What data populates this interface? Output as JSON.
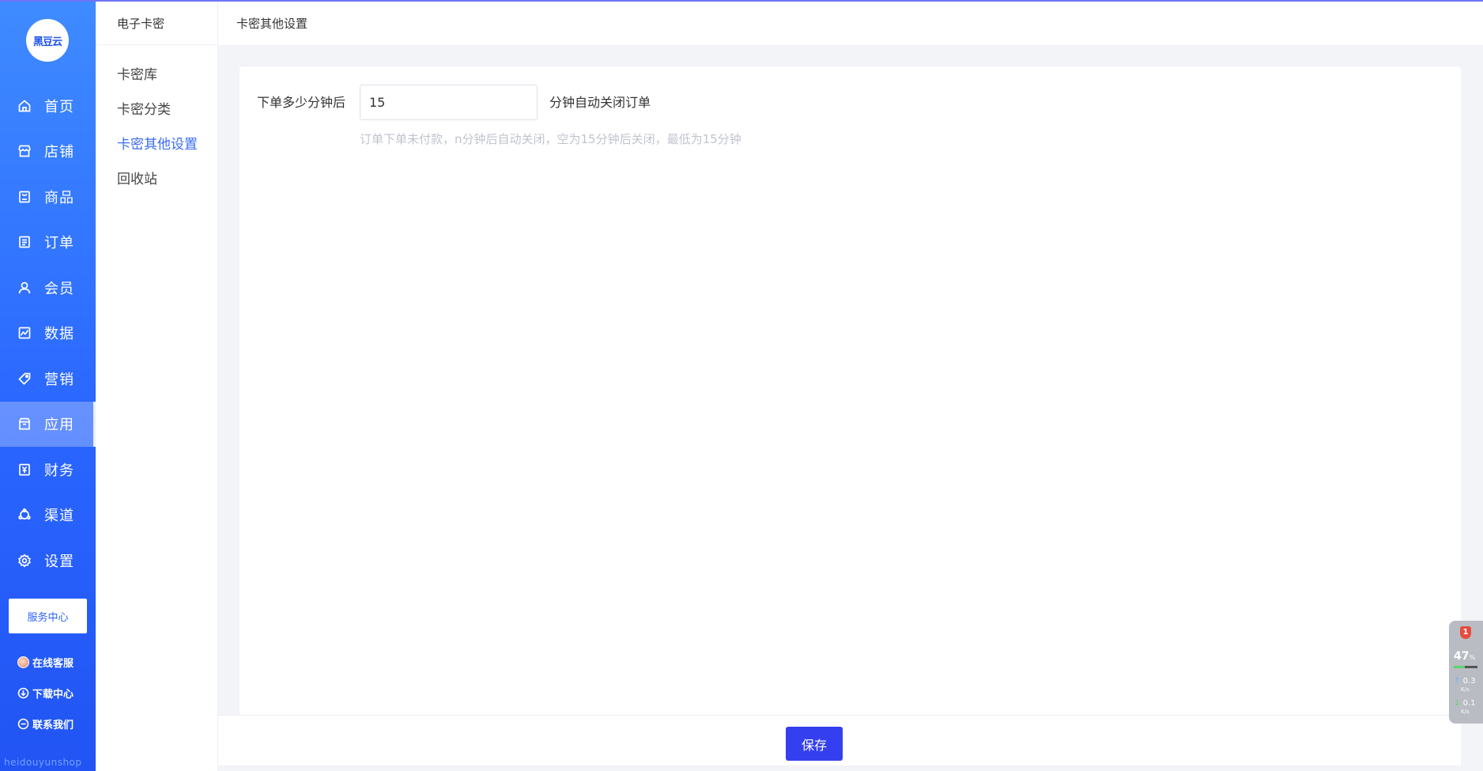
{
  "app": {
    "logo_text": "黑豆云",
    "watermark": "heidouyunshop"
  },
  "colors": {
    "sidebar_primary": "#2a66ff",
    "accent": "#3a6df0",
    "save_button": "#3440f0"
  },
  "sidebar": {
    "items": [
      {
        "label": "首页",
        "icon": "home-icon"
      },
      {
        "label": "店铺",
        "icon": "store-icon"
      },
      {
        "label": "商品",
        "icon": "goods-icon"
      },
      {
        "label": "订单",
        "icon": "order-icon"
      },
      {
        "label": "会员",
        "icon": "member-icon"
      },
      {
        "label": "数据",
        "icon": "data-icon"
      },
      {
        "label": "营销",
        "icon": "tag-icon"
      },
      {
        "label": "应用",
        "icon": "app-icon",
        "active": true
      },
      {
        "label": "财务",
        "icon": "finance-icon"
      },
      {
        "label": "渠道",
        "icon": "channel-icon"
      },
      {
        "label": "设置",
        "icon": "gear-icon"
      }
    ],
    "service_center": "服务中心",
    "bottom_links": [
      {
        "label": "在线客服",
        "icon": "avatar-icon"
      },
      {
        "label": "下载中心",
        "icon": "download-icon"
      },
      {
        "label": "联系我们",
        "icon": "contact-icon"
      }
    ]
  },
  "subnav": {
    "title": "电子卡密",
    "items": [
      {
        "label": "卡密库"
      },
      {
        "label": "卡密分类"
      },
      {
        "label": "卡密其他设置",
        "active": true
      },
      {
        "label": "回收站"
      }
    ]
  },
  "header": {
    "title": "卡密其他设置"
  },
  "form": {
    "label": "下单多少分钟后",
    "value": "15",
    "suffix": "分钟自动关闭订单",
    "hint": "订单下单未付款，n分钟后自动关闭，空为15分钟后关闭，最低为15分钟"
  },
  "footer": {
    "save_label": "保存"
  },
  "system_widget": {
    "badge": "1",
    "cpu_percent": "47",
    "percent_unit": "%",
    "cpu_fraction": 0.47,
    "upload": "0.3",
    "download": "0.1",
    "rate_unit": "K/s"
  }
}
